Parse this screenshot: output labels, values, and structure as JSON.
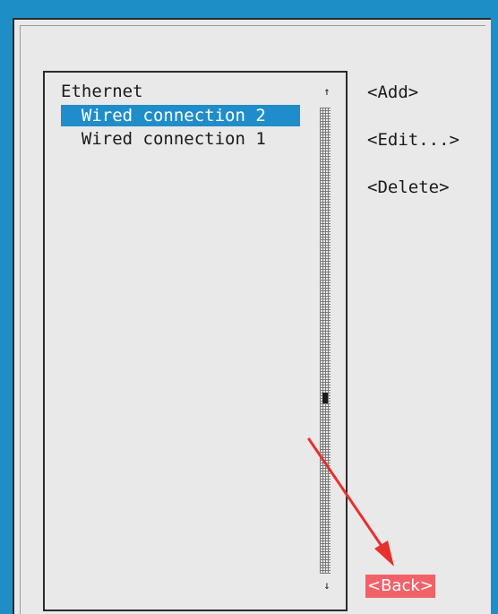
{
  "list": {
    "group_label": "Ethernet",
    "items": [
      {
        "label": "  Wired connection 2",
        "selected": true
      },
      {
        "label": "  Wired connection 1",
        "selected": false
      }
    ],
    "scroll_up_glyph": "↑",
    "scroll_down_glyph": "↓"
  },
  "buttons": {
    "add": "<Add>",
    "edit": "<Edit...>",
    "delete": "<Delete>",
    "back": "<Back>"
  },
  "colors": {
    "titlebar": "#1e8fc6",
    "selection": "#1f8dc9",
    "focused_button": "#f06268",
    "annotation_arrow": "#e8302c"
  }
}
